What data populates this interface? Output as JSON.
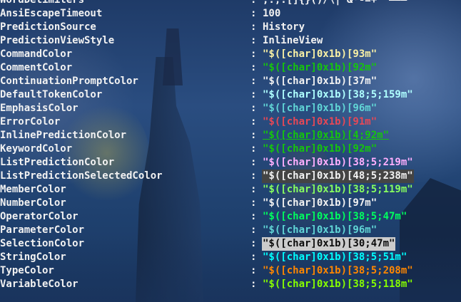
{
  "rows": [
    {
      "name": "WordDelimiters",
      "value": ";:,.[]{}()/\\|^&*-=+'\"–—―",
      "color": "#f2f2f2",
      "bg": "",
      "underline": false
    },
    {
      "name": "AnsiEscapeTimeout",
      "value": "100",
      "color": "#f2f2f2",
      "bg": "",
      "underline": false
    },
    {
      "name": "PredictionSource",
      "value": "History",
      "color": "#f2f2f2",
      "bg": "",
      "underline": false
    },
    {
      "name": "PredictionViewStyle",
      "value": "InlineView",
      "color": "#f2f2f2",
      "bg": "",
      "underline": false
    },
    {
      "name": "CommandColor",
      "value": "\"$([char]0x1b)[93m\"",
      "color": "#f9f1a5",
      "bg": "",
      "underline": false
    },
    {
      "name": "CommentColor",
      "value": "\"$([char]0x1b)[92m\"",
      "color": "#16c60c",
      "bg": "",
      "underline": false
    },
    {
      "name": "ContinuationPromptColor",
      "value": "\"$([char]0x1b)[37m\"",
      "color": "#f2f2f2",
      "bg": "",
      "underline": false
    },
    {
      "name": "DefaultTokenColor",
      "value": "\"$([char]0x1b)[38;5;159m\"",
      "color": "#afffff",
      "bg": "",
      "underline": false
    },
    {
      "name": "EmphasisColor",
      "value": "\"$([char]0x1b)[96m\"",
      "color": "#61d6d6",
      "bg": "",
      "underline": false
    },
    {
      "name": "ErrorColor",
      "value": "\"$([char]0x1b)[91m\"",
      "color": "#e74856",
      "bg": "",
      "underline": false
    },
    {
      "name": "InlinePredictionColor",
      "value": "\"$([char]0x1b)[4;92m\"",
      "color": "#16c60c",
      "bg": "",
      "underline": true
    },
    {
      "name": "KeywordColor",
      "value": "\"$([char]0x1b)[92m\"",
      "color": "#16c60c",
      "bg": "",
      "underline": false
    },
    {
      "name": "ListPredictionColor",
      "value": "\"$([char]0x1b)[38;5;219m\"",
      "color": "#ffafff",
      "bg": "",
      "underline": false
    },
    {
      "name": "ListPredictionSelectedColor",
      "value": "\"$([char]0x1b)[48;5;238m\"",
      "color": "#f2f2f2",
      "bg": "#444444",
      "underline": false
    },
    {
      "name": "MemberColor",
      "value": "\"$([char]0x1b)[38;5;119m\"",
      "color": "#87ff5f",
      "bg": "",
      "underline": false
    },
    {
      "name": "NumberColor",
      "value": "\"$([char]0x1b)[97m\"",
      "color": "#f2f2f2",
      "bg": "",
      "underline": false
    },
    {
      "name": "OperatorColor",
      "value": "\"$([char]0x1b)[38;5;47m\"",
      "color": "#00ff5f",
      "bg": "",
      "underline": false
    },
    {
      "name": "ParameterColor",
      "value": "\"$([char]0x1b)[96m\"",
      "color": "#61d6d6",
      "bg": "",
      "underline": false
    },
    {
      "name": "SelectionColor",
      "value": "\"$([char]0x1b)[30;47m\"",
      "color": "#0c0c0c",
      "bg": "#cccccc",
      "underline": false
    },
    {
      "name": "StringColor",
      "value": "\"$([char]0x1b)[38;5;51m\"",
      "color": "#00ffff",
      "bg": "",
      "underline": false
    },
    {
      "name": "TypeColor",
      "value": "\"$([char]0x1b)[38;5;208m\"",
      "color": "#ff8700",
      "bg": "",
      "underline": false
    },
    {
      "name": "VariableColor",
      "value": "\"$([char]0x1b)[38;5;118m\"",
      "color": "#87ff00",
      "bg": "",
      "underline": false
    }
  ],
  "separator": ":"
}
